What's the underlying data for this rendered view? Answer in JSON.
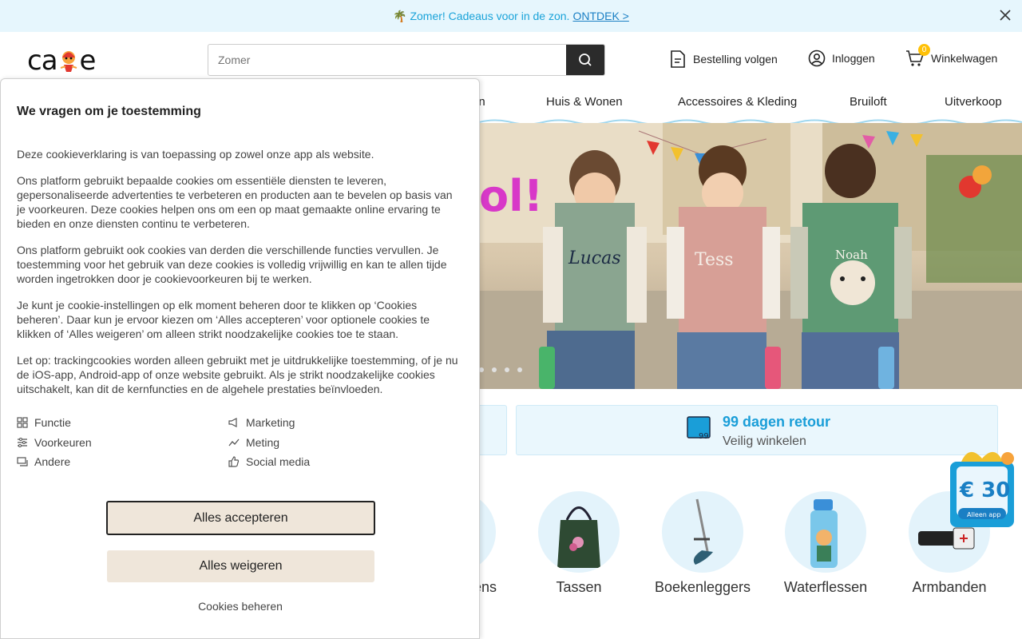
{
  "promo": {
    "emoji": "🌴",
    "text": "Zomer! Cadeaus voor in de zon.",
    "link": "ONTDEK >"
  },
  "logo": {
    "text_left": "ca",
    "text_right": "e"
  },
  "search": {
    "placeholder": "Zomer"
  },
  "header_links": {
    "track": "Bestelling volgen",
    "login": "Inloggen",
    "cart": "Winkelwagen",
    "cart_count": "0"
  },
  "nav": {
    "items": [
      "en",
      "Huis & Wonen",
      "Accessoires & Kleding",
      "Bruiloft",
      "Uitverkoop"
    ]
  },
  "hero": {
    "partial_text": "ol!",
    "bag_names": [
      "Lucas",
      "Tess",
      "Noah"
    ]
  },
  "usp": {
    "title": "99 dagen retour",
    "subtitle": "Veilig winkelen",
    "icon_number": "99"
  },
  "categories": [
    "ens",
    "Tassen",
    "Boekenleggers",
    "Waterflessen",
    "Armbanden"
  ],
  "app_badge": {
    "amount": "€ 30",
    "label": "Alleen app"
  },
  "cookie": {
    "title": "We vragen om je toestemming",
    "paragraphs": [
      "Deze cookieverklaring is van toepassing op zowel onze app als website.",
      "Ons platform gebruikt bepaalde cookies om essentiële diensten te leveren, gepersonaliseerde advertenties te verbeteren en producten aan te bevelen op basis van je voorkeuren. Deze cookies helpen ons om een op maat gemaakte online ervaring te bieden en onze diensten continu te verbeteren.",
      "Ons platform gebruikt ook cookies van derden die verschillende functies vervullen. Je toestemming voor het gebruik van deze cookies is volledig vrijwillig en kan te allen tijde worden ingetrokken door je cookievoorkeuren bij te werken.",
      "Je kunt je cookie-instellingen op elk moment beheren door te klikken op ‘Cookies beheren’. Daar kun je ervoor kiezen om ‘Alles accepteren’ voor optionele cookies te klikken of ‘Alles weigeren’ om alleen strikt noodzakelijke cookies toe te staan.",
      "Let op: trackingcookies worden alleen gebruikt met je uitdrukkelijke toestemming, of je nu de iOS-app, Android-app of onze website gebruikt. Als je strikt noodzakelijke cookies uitschakelt, kan dit de kernfuncties en de algehele prestaties beïnvloeden."
    ],
    "categories": [
      "Functie",
      "Marketing",
      "Voorkeuren",
      "Meting",
      "Andere",
      "Social media"
    ],
    "accept": "Alles accepteren",
    "reject": "Alles weigeren",
    "manage": "Cookies beheren"
  }
}
